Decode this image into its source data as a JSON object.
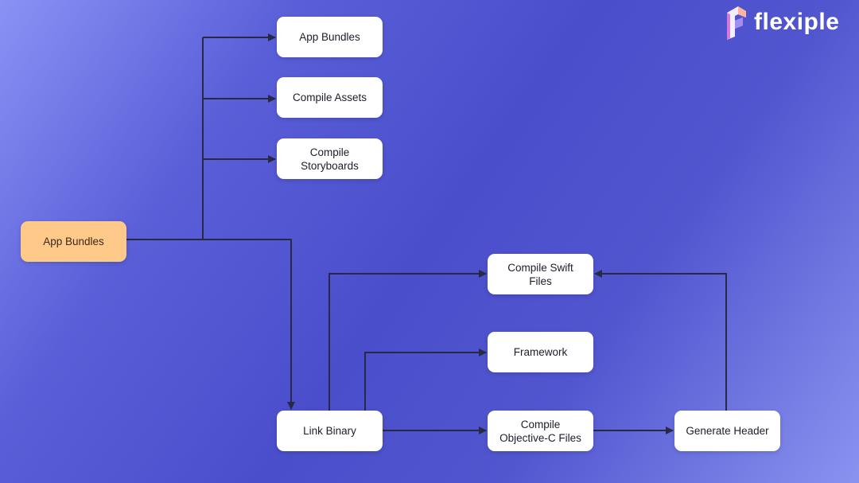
{
  "brand": {
    "name": "flexiple"
  },
  "nodes": {
    "root": "App Bundles",
    "app_bundles": "App Bundles",
    "compile_assets": "Compile Assets",
    "compile_storyboards": "Compile\nStoryboards",
    "compile_swift": "Compile Swift\nFiles",
    "framework": "Framework",
    "link_binary": "Link Binary",
    "compile_objc": "Compile\nObjective-C Files",
    "generate_header": "Generate Header"
  },
  "colors": {
    "root_fill": "#ffc98a",
    "node_fill": "#ffffff",
    "edge": "#262a45"
  },
  "edges": [
    [
      "root",
      "app_bundles"
    ],
    [
      "root",
      "compile_assets"
    ],
    [
      "root",
      "compile_storyboards"
    ],
    [
      "root",
      "link_binary"
    ],
    [
      "link_binary",
      "compile_swift"
    ],
    [
      "link_binary",
      "framework"
    ],
    [
      "link_binary",
      "compile_objc"
    ],
    [
      "compile_objc",
      "generate_header"
    ],
    [
      "generate_header",
      "compile_swift"
    ]
  ]
}
